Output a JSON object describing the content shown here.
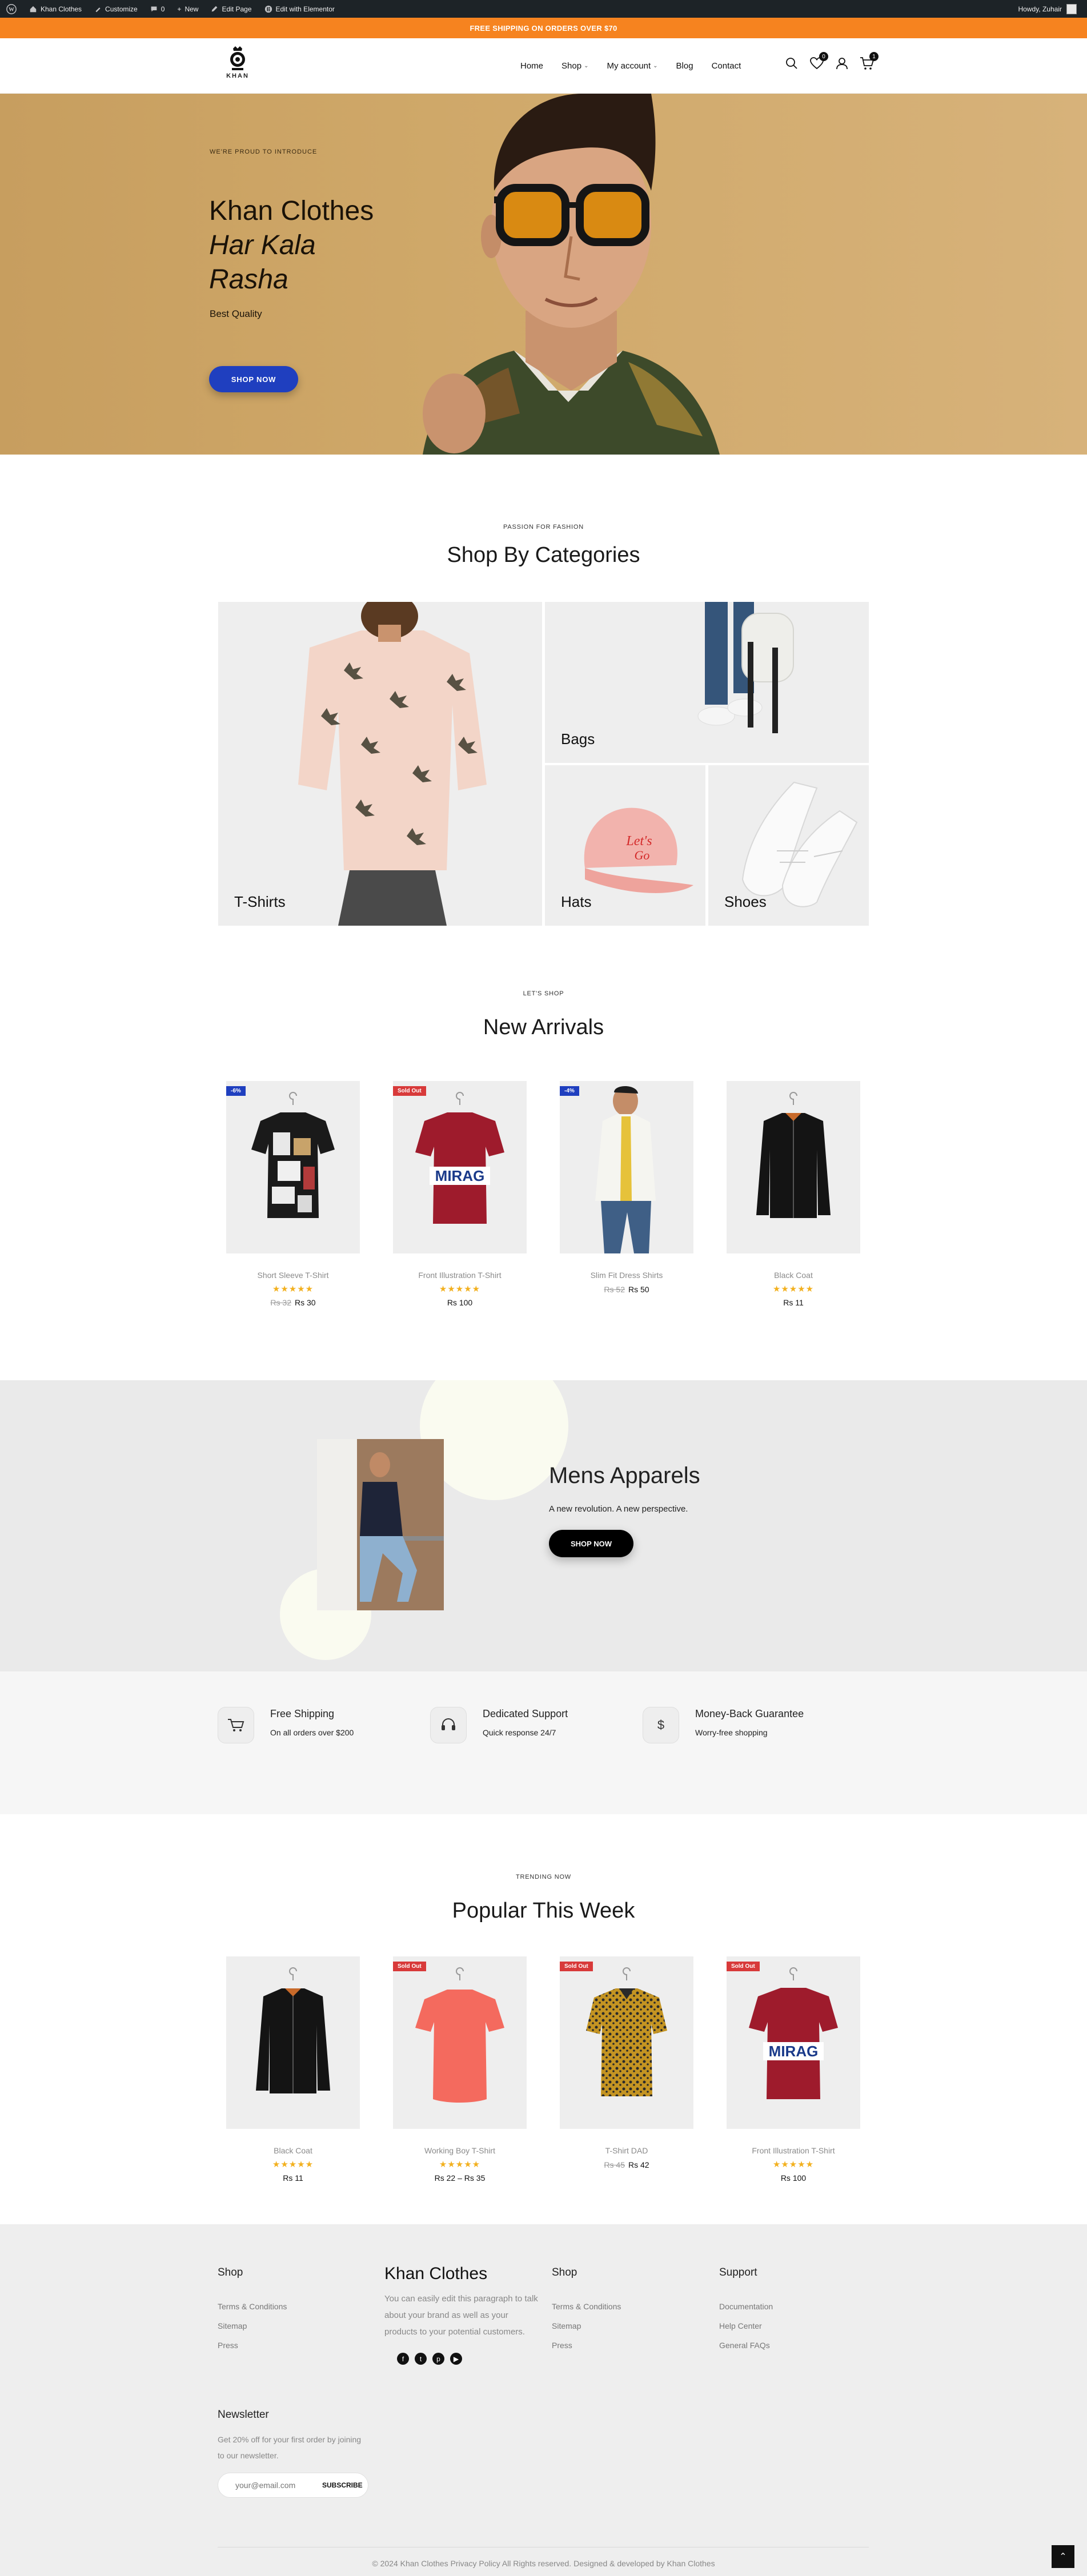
{
  "admin_bar": {
    "site_name": "Khan Clothes",
    "customize": "Customize",
    "comments_count": "0",
    "new": "New",
    "edit_page": "Edit Page",
    "edit_elementor": "Edit with Elementor",
    "greeting": "Howdy, Zuhair"
  },
  "promo_bar": {
    "text": "FREE SHIPPING ON ORDERS OVER $70"
  },
  "header": {
    "logo_text": "KHAN",
    "nav": [
      {
        "label": "Home"
      },
      {
        "label": "Shop"
      },
      {
        "label": "My account"
      },
      {
        "label": "Blog"
      },
      {
        "label": "Contact"
      }
    ],
    "wishlist_count": "0",
    "cart_count": "1"
  },
  "hero": {
    "kicker": "WE'RE PROUD TO INTRODUCE",
    "title_line1": "Khan Clothes",
    "title_line2": "Har Kala",
    "title_line3": "Rasha",
    "subtitle": "Best Quality",
    "button": "SHOP NOW"
  },
  "categories": {
    "kicker": "PASSION FOR FASHION",
    "title": "Shop By Categories",
    "items": [
      {
        "label": "T-Shirts"
      },
      {
        "label": "Bags"
      },
      {
        "label": "Hats"
      },
      {
        "label": "Shoes"
      }
    ]
  },
  "new_arrivals": {
    "kicker": "LET'S SHOP",
    "title": "New Arrivals",
    "products": [
      {
        "badge": "-6%",
        "name": "Short Sleeve T-Shirt",
        "old_price": "Rs 32",
        "price": "Rs 30",
        "rating": 5
      },
      {
        "badge": "Sold Out",
        "name": "Front Illustration T-Shirt",
        "old_price": "",
        "price": "Rs 100",
        "rating": 5
      },
      {
        "badge": "-4%",
        "name": "Slim Fit Dress Shirts",
        "old_price": "Rs 52",
        "price": "Rs 50",
        "rating": 0
      },
      {
        "badge": "",
        "name": "Black Coat",
        "old_price": "",
        "price": "Rs 11",
        "rating": 5
      }
    ]
  },
  "promo": {
    "title": "Mens Apparels",
    "subtitle": "A new revolution. A new perspective.",
    "button": "SHOP NOW"
  },
  "features": [
    {
      "icon": "cart-icon",
      "title": "Free Shipping",
      "desc": "On all orders over $200"
    },
    {
      "icon": "headset-icon",
      "title": "Dedicated Support",
      "desc": "Quick response 24/7"
    },
    {
      "icon": "dollar-icon",
      "title": "Money-Back Guarantee",
      "desc": "Worry-free shopping"
    }
  ],
  "popular": {
    "kicker": "TRENDING NOW",
    "title": "Popular This Week",
    "products": [
      {
        "badge": "",
        "name": "Black Coat",
        "old_price": "",
        "price": "Rs 11",
        "rating": 5
      },
      {
        "badge": "Sold Out",
        "name": "Working Boy T-Shirt",
        "old_price": "",
        "price": "Rs 22 – Rs 35",
        "rating": 5
      },
      {
        "badge": "Sold Out",
        "name": "T-Shirt DAD",
        "old_price": "Rs 45",
        "price": "Rs 42",
        "rating": 0
      },
      {
        "badge": "Sold Out",
        "name": "Front Illustration T-Shirt",
        "old_price": "",
        "price": "Rs 100",
        "rating": 5
      }
    ]
  },
  "footer": {
    "col1": {
      "title": "Shop",
      "links": [
        "Terms & Conditions",
        "Sitemap",
        "Press"
      ]
    },
    "brand": {
      "name": "Khan Clothes",
      "text": "You can easily edit this paragraph to talk about your brand as well as your products to your potential customers."
    },
    "col3": {
      "title": "Shop",
      "links": [
        "Terms & Conditions",
        "Sitemap",
        "Press"
      ]
    },
    "col4": {
      "title": "Support",
      "links": [
        "Documentation",
        "Help Center",
        "General FAQs"
      ]
    },
    "newsletter": {
      "title": "Newsletter",
      "text": "Get 20% off for your first order by joining to our newsletter.",
      "placeholder": "your@email.com",
      "button": "SUBSCRIBE"
    },
    "copyright": "© 2024 Khan Clothes Privacy Policy All Rights reserved. Designed & developed by Khan Clothes"
  },
  "colors": {
    "accent": "#f6831f",
    "primary_button": "#1f3fbf",
    "sold_out": "#d83a3a",
    "star": "#f2b01e"
  }
}
